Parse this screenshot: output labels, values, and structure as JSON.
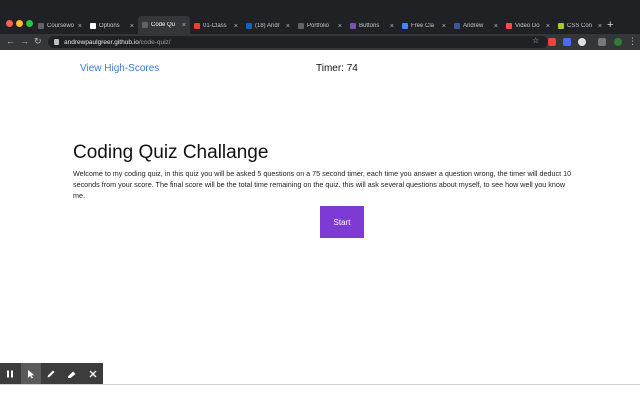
{
  "browser": {
    "tabs": [
      {
        "label": "Coursewo",
        "color": "#5f6368"
      },
      {
        "label": "Options",
        "color": "#ffffff"
      },
      {
        "label": "Code Qu",
        "color": "#5f6368",
        "active": true
      },
      {
        "label": "01-Class",
        "color": "#e24329"
      },
      {
        "label": "(18) Andr",
        "color": "#0a66c2"
      },
      {
        "label": "Portfolio",
        "color": "#5f6368"
      },
      {
        "label": "Buttons",
        "color": "#7952b3"
      },
      {
        "label": "Free Cla",
        "color": "#4285f4"
      },
      {
        "label": "Andrew",
        "color": "#3b5998"
      },
      {
        "label": "Video Do",
        "color": "#ff4d4d"
      },
      {
        "label": "CSS Con",
        "color": "#a4c639"
      }
    ],
    "url_host": "andrewpaulgreer.github.io",
    "url_path": "/code-quiz/"
  },
  "page": {
    "highscores_link": "View High-Scores",
    "timer_label": "Timer: ",
    "timer_value": "74",
    "title": "Coding Quiz Challange",
    "description": "Welcome to my coding quiz, in this quiz you will be asked 5 questions on a 75 second timer, each time you answer a question wrong, the timer will deduct 10 seconds from your score. The final score will be the total time remaining on the quiz. this will ask several questions about myself, to see how well you know me.",
    "start_button": "Start"
  },
  "colors": {
    "accent_button": "#7e3ad4",
    "link": "#3a7bd5"
  },
  "drawing_toolbar": {
    "tools": [
      "pause-icon",
      "cursor-icon",
      "pen-icon",
      "highlighter-icon",
      "close-icon"
    ]
  }
}
